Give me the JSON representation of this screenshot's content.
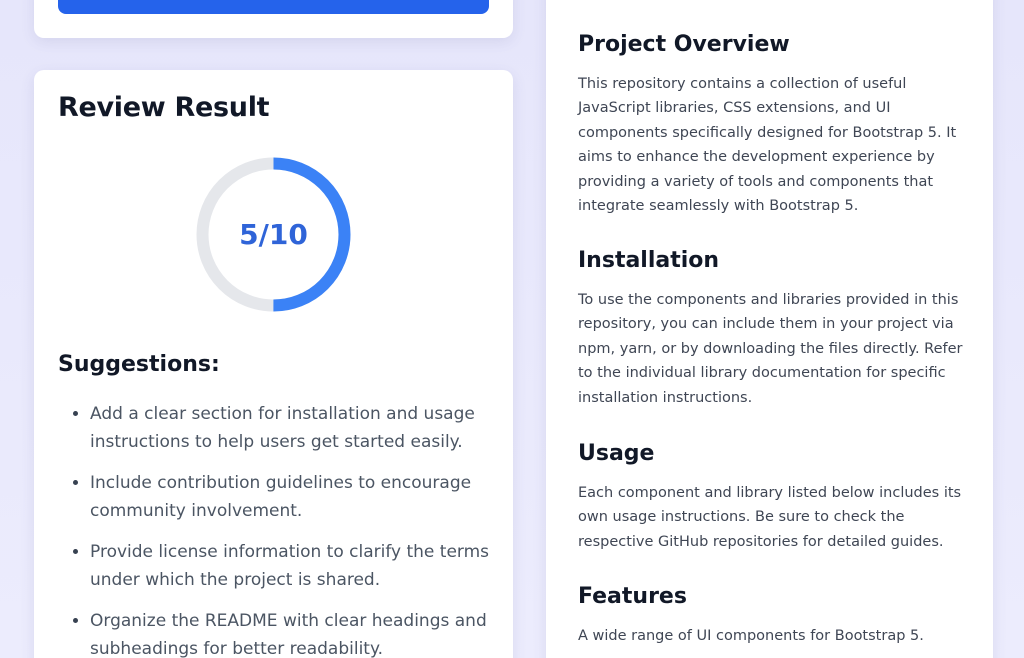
{
  "review": {
    "title": "Review Result",
    "score": {
      "label": "5/10",
      "value": 5,
      "max": 10,
      "ring_color": "#3b82f6",
      "track_color": "#e5e7eb",
      "text_color": "#2f64d8"
    },
    "suggestions_title": "Suggestions:",
    "suggestions": [
      "Add a clear section for installation and usage instructions to help users get started easily.",
      "Include contribution guidelines to encourage community involvement.",
      "Provide license information to clarify the terms under which the project is shared.",
      "Organize the README with clear headings and subheadings for better readability."
    ]
  },
  "colors": {
    "primary_button": "#2563eb",
    "background": "#e6e6fb"
  },
  "readme": {
    "sections": [
      {
        "heading": "Project Overview",
        "body": "This repository contains a collection of useful JavaScript libraries, CSS extensions, and UI components specifically designed for Bootstrap 5. It aims to enhance the development experience by providing a variety of tools and components that integrate seamlessly with Bootstrap 5."
      },
      {
        "heading": "Installation",
        "body": "To use the components and libraries provided in this repository, you can include them in your project via npm, yarn, or by downloading the files directly. Refer to the individual library documentation for specific installation instructions."
      },
      {
        "heading": "Usage",
        "body": "Each component and library listed below includes its own usage instructions. Be sure to check the respective GitHub repositories for detailed guides."
      },
      {
        "heading": "Features",
        "body": "A wide range of UI components for Bootstrap 5."
      }
    ]
  }
}
